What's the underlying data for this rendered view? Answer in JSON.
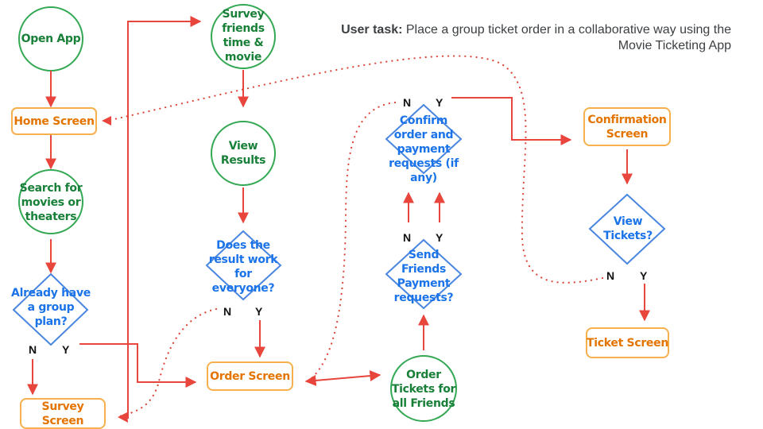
{
  "title": {
    "bold": "User task:",
    "line1": " Place a group ticket order in a collaborative way using the",
    "line2": "Movie Ticketing App"
  },
  "colors": {
    "circle": "#34a853",
    "circle_text": "#188038",
    "rect": "#f6b04d",
    "rect_text": "#e37400",
    "diamond": "#4a86e0",
    "diamond_text": "#1a73e8",
    "arrow": "#e8453c"
  },
  "nodes": {
    "open_app": "Open App",
    "home_screen": "Home Screen",
    "search": "Search for movies or theaters",
    "group_plan": "Already have a group plan?",
    "survey_screen": "Survey Screen",
    "survey_friends": "Survey friends time & movie",
    "view_results": "View Results",
    "result_work": "Does the result work for everyone?",
    "order_screen": "Order Screen",
    "order_tickets": "Order Tickets for all Friends",
    "send_payment": "Send Friends Payment requests?",
    "confirm_order": "Confirm order and payment requests (if any)",
    "confirmation_screen": "Confirmation Screen",
    "view_tickets": "View Tickets?",
    "ticket_screen": "Ticket Screen"
  },
  "labels": {
    "no": "N",
    "yes": "Y"
  }
}
